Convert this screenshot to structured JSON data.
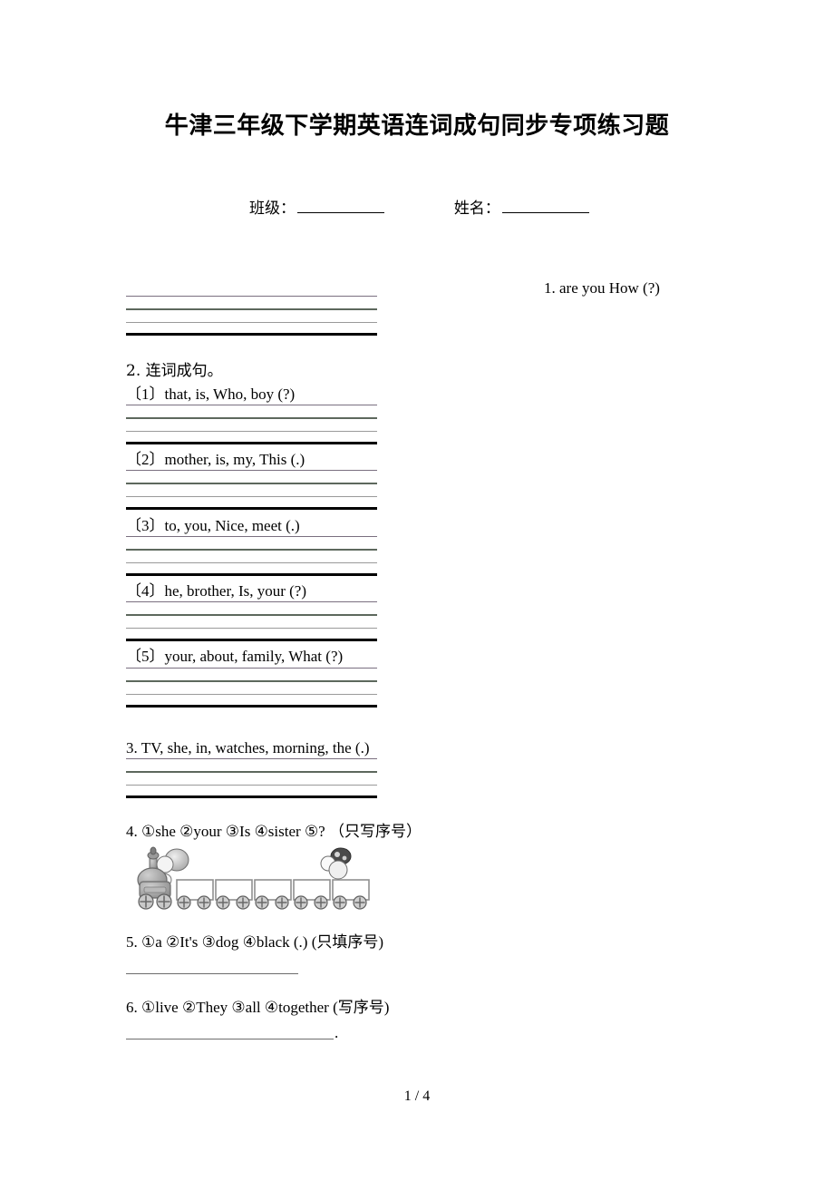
{
  "document": {
    "title": "牛津三年级下学期英语连词成句同步专项练习题",
    "footer": "1 / 4"
  },
  "header_fields": {
    "class_label": "班级：",
    "name_label": "姓名："
  },
  "questions": [
    {
      "id": "q1",
      "number": "1.",
      "text": "1. are    you    How (?)",
      "answer_lines": 4
    },
    {
      "id": "q2",
      "number": "2.",
      "heading": "2. 连词成句。",
      "items": [
        {
          "label": "〔1〕",
          "text": "〔1〕that, is, Who, boy (?)"
        },
        {
          "label": "〔2〕",
          "text": "〔2〕mother, is, my, This (.)"
        },
        {
          "label": "〔3〕",
          "text": "〔3〕to, you, Nice, meet (.)"
        },
        {
          "label": "〔4〕",
          "text": "〔4〕he, brother, Is, your (?)"
        },
        {
          "label": "〔5〕",
          "text": "〔5〕your, about, family, What (?)"
        }
      ]
    },
    {
      "id": "q3",
      "number": "3.",
      "text": "3. TV, she, in, watches, morning, the (.)",
      "answer_lines": 4
    },
    {
      "id": "q4",
      "number": "4.",
      "text": "4. ①she  ②your  ③Is  ④sister  ⑤? （只写序号）",
      "illustration": "train-clipart",
      "illustration_boxcars": 5
    },
    {
      "id": "q5",
      "number": "5.",
      "text": "5. ①a   ②It's   ③dog   ④black (.) (只填序号)",
      "answer_rule": true
    },
    {
      "id": "q6",
      "number": "6.",
      "text": "6. ①live  ②They  ③all  ④together (写序号)",
      "answer_rule": true,
      "trailing_punctuation": "."
    }
  ],
  "colors": {
    "page_background": "#ffffff",
    "text": "#000000",
    "rule_thin_purple": "#7a6f80",
    "rule_green": "#5d685d",
    "rule_gray": "#9a9a9a",
    "rule_black": "#000000",
    "train_body": "#8d8d8d",
    "train_outline": "#6b6b6b"
  }
}
